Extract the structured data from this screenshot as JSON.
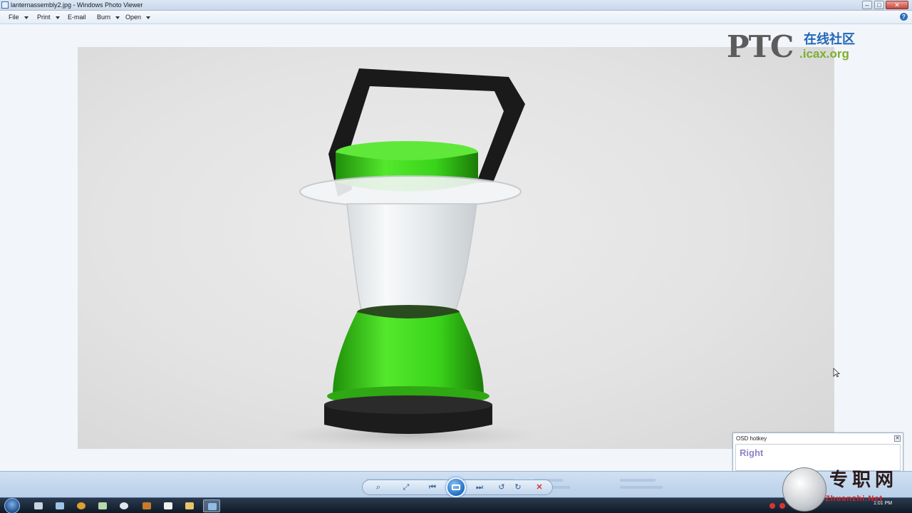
{
  "window": {
    "title": "lanternassembly2.jpg - Windows Photo Viewer",
    "minimize_glyph": "–",
    "maximize_glyph": "□",
    "close_glyph": "✕"
  },
  "menu": {
    "file": "File",
    "print": "Print",
    "email": "E-mail",
    "burn": "Burn",
    "open": "Open",
    "help_glyph": "?"
  },
  "watermark": {
    "brand": "PTC",
    "cn_text": "在线社区",
    "domain": ".icax.org"
  },
  "osd": {
    "title": "OSD hotkey",
    "value": "Right",
    "close_glyph": "✕"
  },
  "controls": {
    "zoom_glyph": "⌕",
    "fit_glyph": "⤢",
    "prev_glyph": "⏮",
    "next_glyph": "⏭",
    "rotate_ccw_glyph": "↺",
    "rotate_cw_glyph": "↻",
    "delete_glyph": "✕"
  },
  "taskbar": {
    "clock": "1:01 PM"
  },
  "corner_logo": {
    "cn_text": "专职网",
    "en_text": "Zhuanzhi.Net"
  },
  "colors": {
    "lantern_green": "#39d41a",
    "handle_black": "#1a1a1a",
    "osd_text": "#8c85c6",
    "delete_red": "#d03a2a"
  },
  "icons": {
    "app": "photo-viewer-icon",
    "cursor": "mouse-cursor-icon",
    "slideshow": "slideshow-icon"
  }
}
